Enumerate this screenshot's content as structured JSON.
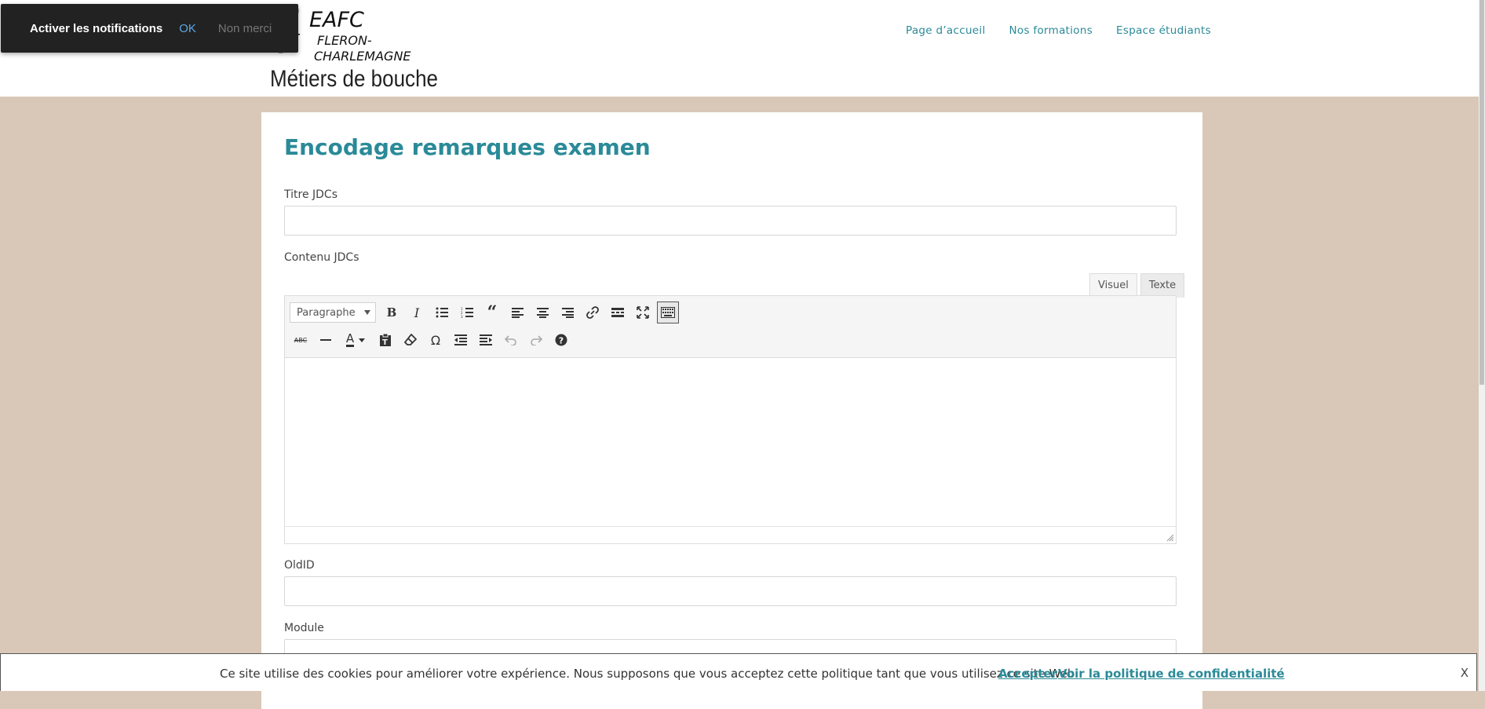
{
  "notification": {
    "message": "Activer les notifications",
    "ok_label": "OK",
    "decline_label": "Non merci"
  },
  "header": {
    "logo": {
      "line1": "EAFC",
      "line2": "FLERON-",
      "line3": "CHARLEMAGNE",
      "line4": "Métiers de bouche"
    },
    "nav": {
      "home": "Page d’accueil",
      "formations": "Nos formations",
      "students": "Espace étudiants"
    }
  },
  "main": {
    "title": "Encodage remarques examen",
    "fields": {
      "titre_label": "Titre JDCs",
      "titre_value": "",
      "contenu_label": "Contenu JDCs",
      "oldid_label": "OldID",
      "oldid_value": "",
      "module_label": "Module",
      "module_value": ""
    },
    "editor": {
      "tab_visual": "Visuel",
      "tab_text": "Texte",
      "format_selected": "Paragraphe",
      "content": "",
      "toolbar_row1": [
        "bold-icon",
        "italic-icon",
        "bullet-list-icon",
        "numbered-list-icon",
        "blockquote-icon",
        "align-left-icon",
        "align-center-icon",
        "align-right-icon",
        "link-icon",
        "read-more-icon",
        "fullscreen-icon",
        "toolbar-toggle-icon"
      ],
      "toolbar_row2": [
        "strikethrough-icon",
        "horizontal-rule-icon",
        "text-color-icon",
        "paste-text-icon",
        "clear-formatting-icon",
        "special-character-icon",
        "outdent-icon",
        "indent-icon",
        "undo-icon",
        "redo-icon",
        "help-icon"
      ]
    }
  },
  "cookie_bar": {
    "text": "Ce site utilise des cookies pour améliorer votre expérience. Nous supposons que vous acceptez cette politique tant que vous utilisez ce site Web",
    "accept_label": "Accepter",
    "policy_label": "Voir la politique de confidentialité",
    "close_label": "X"
  },
  "colors": {
    "accent": "#2a8a98",
    "page_background": "#d9c8b8",
    "notification_background": "#222222",
    "notification_ok": "#5aa7e8"
  }
}
